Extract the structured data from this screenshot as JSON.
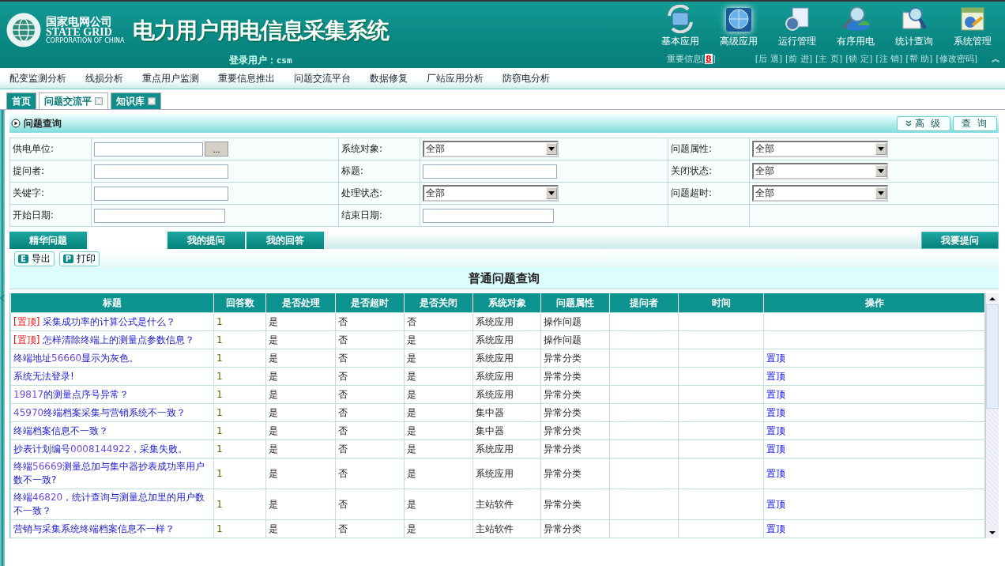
{
  "header": {
    "company_cn": "国家电网公司",
    "company_en": "STATE GRID",
    "company_sub": "CORPORATION OF CHINA",
    "system_title": "电力用户用电信息采集系统",
    "login_label": "登录用户：",
    "login_user": "csm",
    "notice_label": "重要信息[",
    "notice_count": "8",
    "notice_end": "]",
    "modules": [
      {
        "label": "基本应用",
        "selected": false
      },
      {
        "label": "高级应用",
        "selected": true
      },
      {
        "label": "运行管理",
        "selected": false
      },
      {
        "label": "有序用电",
        "selected": false
      },
      {
        "label": "统计查询",
        "selected": false
      },
      {
        "label": "系统管理",
        "selected": false
      }
    ],
    "links": [
      "[后 退]",
      "[前 进]",
      "[主 页]",
      "[锁 定]",
      "[注 销]",
      "[帮 助]",
      "[修改密码]"
    ],
    "collapse": "︽"
  },
  "menu": [
    "配变监测分析",
    "线损分析",
    "重点用户监测",
    "重要信息推出",
    "问题交流平台",
    "数据修复",
    "厂站应用分析",
    "防窃电分析"
  ],
  "page_tabs": [
    {
      "label": "首页",
      "selected": false,
      "closable": false
    },
    {
      "label": "问题交流平",
      "selected": true,
      "closable": true
    },
    {
      "label": "知识库",
      "selected": false,
      "closable": true
    }
  ],
  "query": {
    "title": "问题查询",
    "buttons": [
      {
        "label": "高 级",
        "kind": "expand"
      },
      {
        "label": "查 询",
        "kind": "plain"
      }
    ],
    "rows": [
      [
        {
          "label": "供电单位:",
          "kind": "picker",
          "button": "..."
        },
        {
          "label": "系统对象:",
          "kind": "select",
          "value": "全部"
        },
        {
          "label": "问题属性:",
          "kind": "select",
          "value": "全部"
        }
      ],
      [
        {
          "label": "提问者:",
          "kind": "input"
        },
        {
          "label": "标题:",
          "kind": "input"
        },
        {
          "label": "关闭状态:",
          "kind": "select",
          "value": "全部"
        }
      ],
      [
        {
          "label": "关键字:",
          "kind": "input"
        },
        {
          "label": "处理状态:",
          "kind": "select",
          "value": "全部"
        },
        {
          "label": "问题超时:",
          "kind": "select",
          "value": "全部"
        }
      ],
      [
        {
          "label": "开始日期:",
          "kind": "date"
        },
        {
          "label": "结束日期:",
          "kind": "date"
        },
        {
          "kind": "empty"
        }
      ]
    ]
  },
  "sub_tabs": [
    {
      "label": "精华问题",
      "selected": false
    },
    {
      "selected": true
    },
    {
      "label": "我的提问",
      "selected": false
    },
    {
      "label": "我的回答",
      "selected": false
    }
  ],
  "ask_button": "我要提问",
  "toolbar": [
    {
      "key": "E",
      "label": "导出"
    },
    {
      "key": "P",
      "label": "打印"
    }
  ],
  "list_title": "普通问题查询",
  "table": {
    "columns": [
      "标题",
      "回答数",
      "是否处理",
      "是否超时",
      "是否关闭",
      "系统对象",
      "问题属性",
      "提问者",
      "时间",
      "操作"
    ],
    "rows": [
      {
        "title": [
          {
            "kind": "tag",
            "text": "[置顶]"
          },
          {
            "kind": "text",
            "text": " 采集成功率的计算公式是什么？"
          }
        ],
        "answers": "1",
        "handled": "是",
        "overtime": "否",
        "closed": "否",
        "object": "系统应用",
        "attribute": "操作问题"
      },
      {
        "title": [
          {
            "kind": "tag",
            "text": "[置顶]"
          },
          {
            "kind": "text",
            "text": " 怎样清除终端上的测量点参数信息？"
          }
        ],
        "answers": "1",
        "handled": "是",
        "overtime": "否",
        "closed": "是",
        "object": "系统应用",
        "attribute": "操作问题"
      },
      {
        "title": [
          {
            "kind": "text",
            "text": "终端地址"
          },
          {
            "kind": "number",
            "text": "56660"
          },
          {
            "kind": "text",
            "text": "显示为灰色。"
          }
        ],
        "answers": "1",
        "handled": "是",
        "overtime": "否",
        "closed": "是",
        "object": "系统应用",
        "attribute": "异常分类",
        "action": "置顶"
      },
      {
        "title": [
          {
            "kind": "text",
            "text": "系统无法登录!"
          }
        ],
        "answers": "1",
        "handled": "是",
        "overtime": "否",
        "closed": "是",
        "object": "系统应用",
        "attribute": "异常分类",
        "action": "置顶"
      },
      {
        "title": [
          {
            "kind": "number",
            "text": "19817"
          },
          {
            "kind": "text",
            "text": "的测量点序号异常？"
          }
        ],
        "answers": "1",
        "handled": "是",
        "overtime": "否",
        "closed": "是",
        "object": "系统应用",
        "attribute": "异常分类",
        "action": "置顶"
      },
      {
        "title": [
          {
            "kind": "number",
            "text": "45970"
          },
          {
            "kind": "text",
            "text": "终端档案采集与营销系统不一致？"
          }
        ],
        "answers": "1",
        "handled": "是",
        "overtime": "否",
        "closed": "是",
        "object": "集中器",
        "attribute": "异常分类",
        "action": "置顶"
      },
      {
        "title": [
          {
            "kind": "text",
            "text": "终端档案信息不一致？"
          }
        ],
        "answers": "1",
        "handled": "是",
        "overtime": "否",
        "closed": "是",
        "object": "集中器",
        "attribute": "异常分类",
        "action": "置顶"
      },
      {
        "title": [
          {
            "kind": "text",
            "text": "抄表计划编号"
          },
          {
            "kind": "number",
            "text": "0008144922"
          },
          {
            "kind": "text",
            "text": "，采集失败。"
          }
        ],
        "answers": "1",
        "handled": "是",
        "overtime": "否",
        "closed": "是",
        "object": "系统应用",
        "attribute": "异常分类",
        "action": "置顶"
      },
      {
        "title": [
          {
            "kind": "text",
            "text": "终端"
          },
          {
            "kind": "number",
            "text": "56669"
          },
          {
            "kind": "text",
            "text": "测量总加与集中器抄表成功率用户数不一致?"
          }
        ],
        "answers": "1",
        "handled": "是",
        "overtime": "否",
        "closed": "是",
        "object": "系统应用",
        "attribute": "异常分类",
        "action": "置顶"
      },
      {
        "title": [
          {
            "kind": "text",
            "text": "终端"
          },
          {
            "kind": "number",
            "text": "46820"
          },
          {
            "kind": "text",
            "text": "，统计查询与测量总加里的用户数不一致？"
          }
        ],
        "answers": "1",
        "handled": "是",
        "overtime": "否",
        "closed": "是",
        "object": "主站软件",
        "attribute": "异常分类",
        "action": "置顶"
      },
      {
        "title": [
          {
            "kind": "text",
            "text": "营销与采集系统终端档案信息不一样？"
          }
        ],
        "answers": "1",
        "handled": "是",
        "overtime": "否",
        "closed": "是",
        "object": "主站软件",
        "attribute": "异常分类",
        "action": "置顶"
      }
    ]
  }
}
